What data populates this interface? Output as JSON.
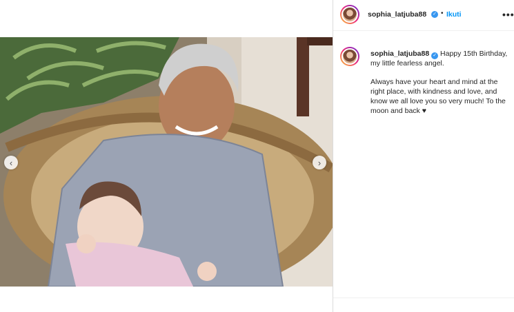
{
  "post": {
    "username": "sophia_latjuba88",
    "verified_icon": "verified-badge-icon",
    "follow_label": "Ikuti",
    "separator": "•",
    "more_icon": "more-options-icon",
    "caption_line1": "Happy 15th Birthday, my little fearless angel.",
    "caption_line2": "Always have your heart and mind at the right place, with kindness and love, and know we all love you so very much! To the moon and back ♥"
  },
  "carousel": {
    "prev_icon": "chevron-left-icon",
    "next_icon": "chevron-right-icon"
  },
  "colors": {
    "accent": "#0095f6",
    "verified": "#3897f0",
    "divider": "#dbdbdb"
  }
}
